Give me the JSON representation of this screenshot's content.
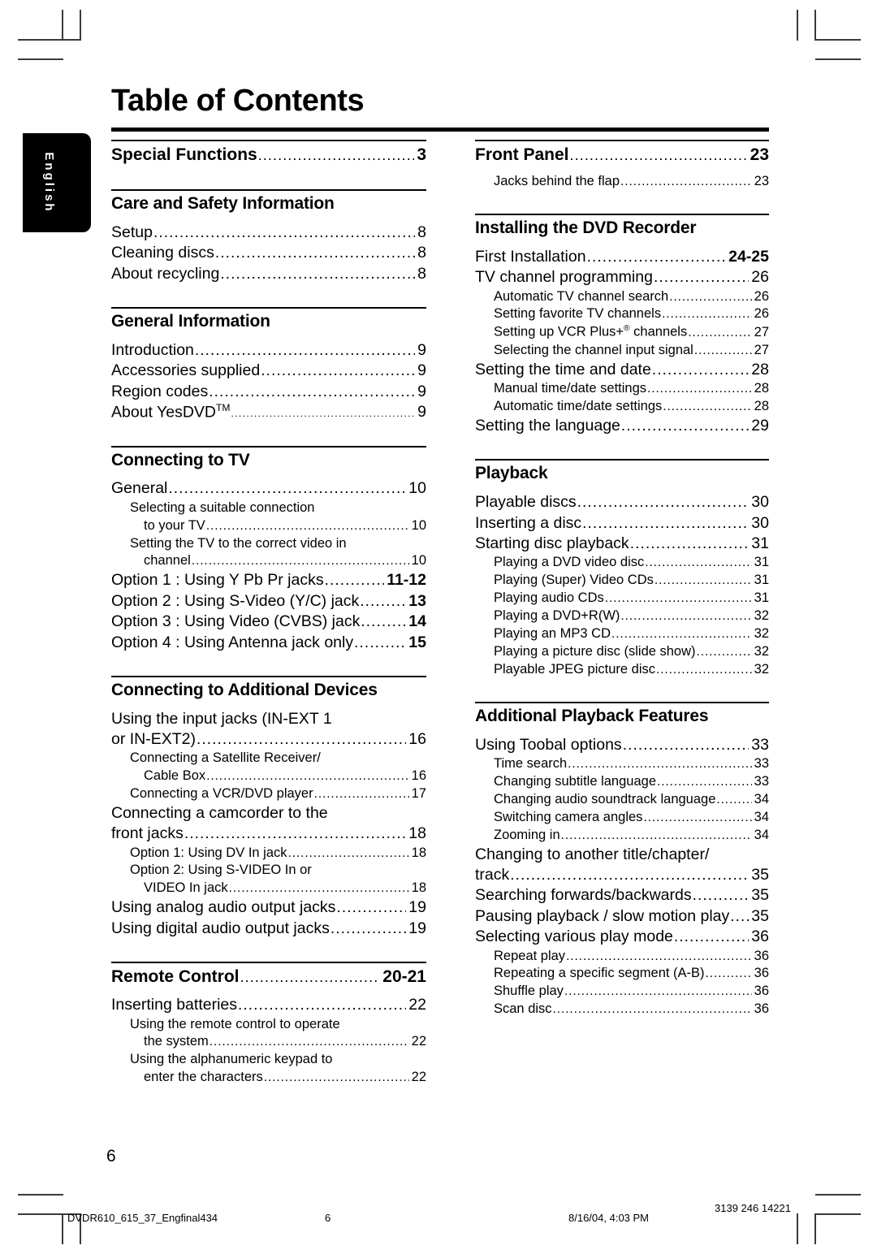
{
  "document": {
    "title": "Table of Contents",
    "language_tab": "English",
    "folio": "6"
  },
  "footer": {
    "filename": "DVDR610_615_37_Engfinal434",
    "page": "6",
    "timestamp": "8/16/04, 4:03 PM",
    "code": "3139 246 14221"
  },
  "columns": {
    "left": [
      {
        "type": "head-entry",
        "name": "Special Functions",
        "page": "3"
      },
      {
        "type": "section",
        "head": "Care and Safety Information",
        "entries": [
          {
            "level": 1,
            "name": "Setup",
            "page": "8"
          },
          {
            "level": 1,
            "name": "Cleaning discs",
            "page": "8"
          },
          {
            "level": 1,
            "name": "About recycling",
            "page": "8"
          }
        ]
      },
      {
        "type": "section",
        "head": "General Information",
        "entries": [
          {
            "level": 1,
            "name": "Introduction",
            "page": "9"
          },
          {
            "level": 1,
            "name": "Accessories supplied",
            "page": "9"
          },
          {
            "level": 1,
            "name": "Region codes",
            "page": "9"
          },
          {
            "level": 1,
            "name": "About YesDVD",
            "sup": "TM",
            "page": "9",
            "fine": true
          }
        ]
      },
      {
        "type": "section",
        "head": "Connecting to TV",
        "entries": [
          {
            "level": 1,
            "name": "General",
            "page": "10"
          },
          {
            "level": 2,
            "plain": "Selecting a suitable connection"
          },
          {
            "level": 2,
            "cont": true,
            "name": "to your TV",
            "page": "10"
          },
          {
            "level": 2,
            "plain": "Setting the TV to the correct video in"
          },
          {
            "level": 2,
            "cont": true,
            "name": "channel",
            "page": "10"
          },
          {
            "level": 1,
            "name": "Option 1 : Using Y Pb Pr jacks",
            "page": "11-12",
            "boldpage": true
          },
          {
            "level": 1,
            "name": "Option 2 : Using S-Video (Y/C) jack",
            "page": "13",
            "boldpage": true
          },
          {
            "level": 1,
            "name": "Option 3 : Using Video (CVBS) jack",
            "page": "14",
            "boldpage": true
          },
          {
            "level": 1,
            "name": "Option 4 : Using Antenna jack only",
            "page": "15",
            "boldpage": true
          }
        ]
      },
      {
        "type": "section",
        "head": "Connecting to Additional Devices",
        "entries": [
          {
            "level": 1,
            "plain": "Using the input jacks (IN-EXT 1"
          },
          {
            "level": 1,
            "name": "or IN-EXT2)",
            "page": "16"
          },
          {
            "level": 2,
            "plain": "Connecting a Satellite Receiver/"
          },
          {
            "level": 2,
            "cont": true,
            "name": "Cable Box",
            "page": "16"
          },
          {
            "level": 2,
            "name": "Connecting a VCR/DVD player",
            "page": "17"
          },
          {
            "level": 1,
            "plain": "Connecting a camcorder to the"
          },
          {
            "level": 1,
            "name": "front jacks",
            "page": "18"
          },
          {
            "level": 2,
            "name": "Option 1: Using DV In jack",
            "page": "18"
          },
          {
            "level": 2,
            "plain": "Option 2: Using S-VIDEO In or"
          },
          {
            "level": 2,
            "cont": true,
            "name": "VIDEO In jack",
            "page": "18"
          },
          {
            "level": 1,
            "name": "Using analog audio output jacks",
            "page": "19"
          },
          {
            "level": 1,
            "name": "Using digital audio output jacks",
            "page": "19"
          }
        ]
      },
      {
        "type": "head-entry-section",
        "head": "Remote Control",
        "head_page": "20-21",
        "entries": [
          {
            "level": 1,
            "name": "Inserting batteries",
            "page": "22"
          },
          {
            "level": 2,
            "plain": "Using the remote control to operate"
          },
          {
            "level": 2,
            "cont": true,
            "name": "the system",
            "page": "22"
          },
          {
            "level": 2,
            "plain": "Using the alphanumeric keypad to"
          },
          {
            "level": 2,
            "cont": true,
            "name": "enter the characters",
            "page": "22"
          }
        ]
      }
    ],
    "right": [
      {
        "type": "head-entry-section",
        "head": "Front Panel",
        "head_page": "23",
        "entries": [
          {
            "level": 2,
            "name": "Jacks behind the flap",
            "page": "23"
          }
        ]
      },
      {
        "type": "section",
        "head": "Installing the DVD Recorder",
        "entries": [
          {
            "level": 1,
            "name": "First Installation",
            "page": "24-25",
            "boldpage": true
          },
          {
            "level": 1,
            "name": "TV channel programming",
            "page": "26"
          },
          {
            "level": 2,
            "name": "Automatic TV channel search",
            "page": "26"
          },
          {
            "level": 2,
            "name": "Setting favorite TV channels",
            "page": "26"
          },
          {
            "level": 2,
            "name": "Setting up VCR Plus+",
            "sup": "®",
            "page": "27",
            "suffix": " channels"
          },
          {
            "level": 2,
            "name": "Selecting the channel input signal",
            "page": "27"
          },
          {
            "level": 1,
            "name": "Setting the time and date",
            "page": "28"
          },
          {
            "level": 2,
            "name": "Manual time/date settings",
            "page": "28"
          },
          {
            "level": 2,
            "name": "Automatic time/date settings",
            "page": "28"
          },
          {
            "level": 1,
            "name": "Setting the language",
            "page": "29"
          }
        ]
      },
      {
        "type": "section",
        "head": "Playback",
        "entries": [
          {
            "level": 1,
            "name": "Playable discs",
            "page": "30"
          },
          {
            "level": 1,
            "name": "Inserting a disc",
            "page": "30"
          },
          {
            "level": 1,
            "name": "Starting disc playback",
            "page": "31"
          },
          {
            "level": 2,
            "name": "Playing a DVD video disc",
            "page": "31"
          },
          {
            "level": 2,
            "name": "Playing (Super) Video CDs",
            "page": "31"
          },
          {
            "level": 2,
            "name": "Playing audio CDs",
            "page": "31"
          },
          {
            "level": 2,
            "name": "Playing a DVD+R(W)",
            "page": "32"
          },
          {
            "level": 2,
            "name": "Playing an MP3 CD",
            "page": "32"
          },
          {
            "level": 2,
            "name": "Playing a picture disc (slide show)",
            "page": "32"
          },
          {
            "level": 2,
            "name": "Playable JPEG picture disc",
            "page": "32"
          }
        ]
      },
      {
        "type": "section",
        "head": "Additional Playback Features",
        "entries": [
          {
            "level": 1,
            "name": "Using Toobal options",
            "page": "33"
          },
          {
            "level": 2,
            "name": "Time search",
            "page": "33"
          },
          {
            "level": 2,
            "name": "Changing subtitle language",
            "page": "33"
          },
          {
            "level": 2,
            "name": "Changing audio soundtrack language",
            "page": "34"
          },
          {
            "level": 2,
            "name": "Switching camera angles",
            "page": "34"
          },
          {
            "level": 2,
            "name": "Zooming in",
            "page": "34"
          },
          {
            "level": 1,
            "plain": "Changing to another title/chapter/"
          },
          {
            "level": 1,
            "name": "track",
            "page": "35"
          },
          {
            "level": 1,
            "name": "Searching forwards/backwards",
            "page": "35"
          },
          {
            "level": 1,
            "name": "Pausing playback / slow motion play",
            "page": "35"
          },
          {
            "level": 1,
            "name": "Selecting various play mode",
            "page": "36"
          },
          {
            "level": 2,
            "name": "Repeat play",
            "page": "36"
          },
          {
            "level": 2,
            "name": "Repeating a specific segment (A-B)",
            "page": "36"
          },
          {
            "level": 2,
            "name": "Shuffle play",
            "page": "36"
          },
          {
            "level": 2,
            "name": "Scan disc",
            "page": "36"
          }
        ]
      }
    ]
  }
}
